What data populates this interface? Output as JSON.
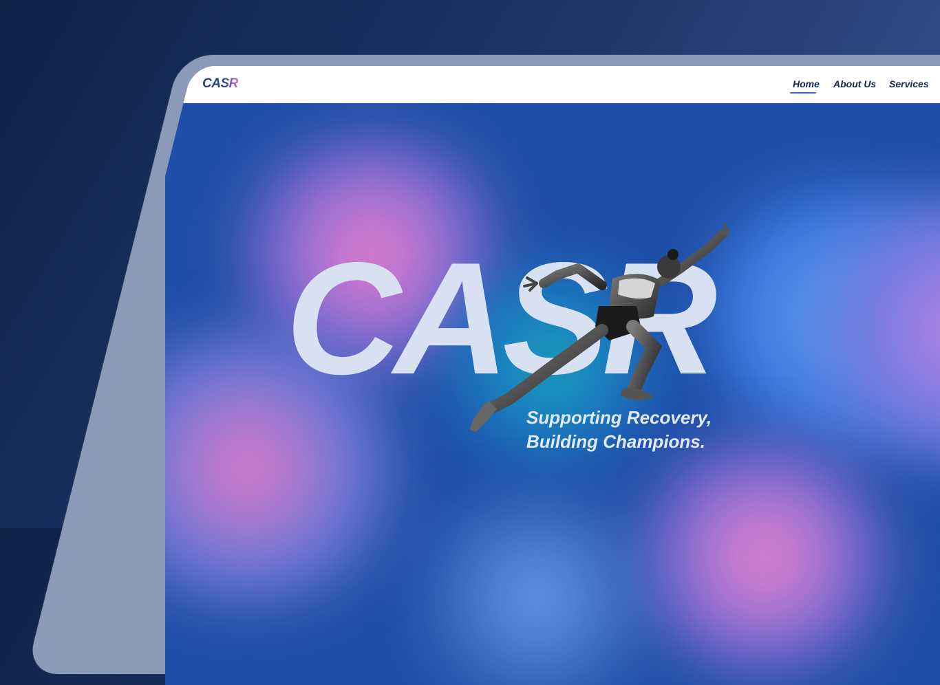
{
  "site": {
    "logo": "CASR",
    "logo_colors": [
      "#23428a",
      "#c06ad8"
    ]
  },
  "nav": {
    "items": [
      {
        "label": "Home",
        "active": true
      },
      {
        "label": "About Us",
        "active": false
      },
      {
        "label": "Services",
        "active": false
      }
    ]
  },
  "hero": {
    "title": "CASR",
    "tagline_line1": "Supporting Recovery,",
    "tagline_line2": "Building Champions.",
    "image": "sprinter-athlete-photo"
  },
  "colors": {
    "background": "#1d3466",
    "hero_blue": "#1f4fa8",
    "pink_glow": "#f07ec8",
    "title_text": "#d8e1f2"
  }
}
